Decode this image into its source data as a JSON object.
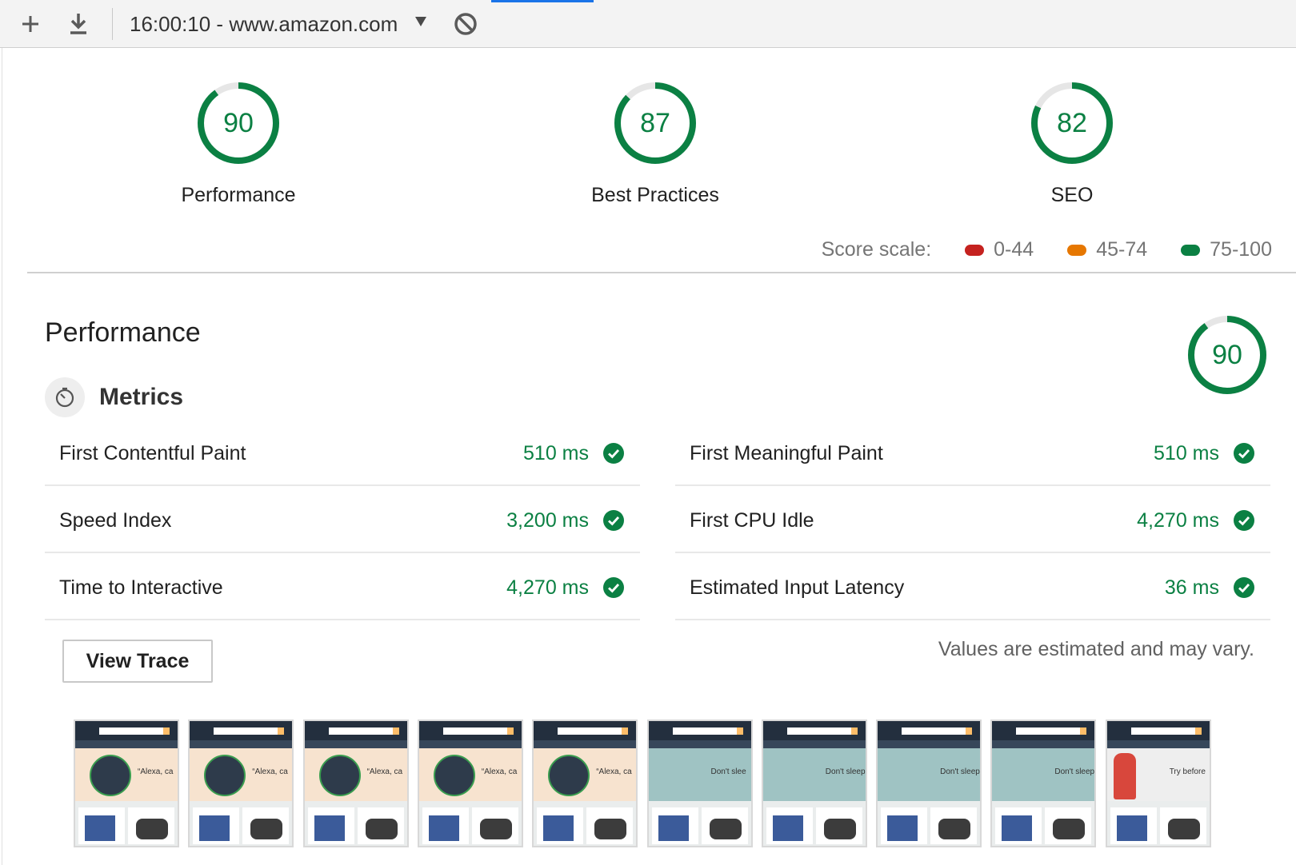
{
  "toolbar": {
    "url_label": "16:00:10 - www.amazon.com",
    "icons": [
      "plus-icon",
      "download-icon",
      "caret-down-icon",
      "block-icon"
    ]
  },
  "categories": [
    {
      "name": "Performance",
      "score": 90
    },
    {
      "name": "Best Practices",
      "score": 87
    },
    {
      "name": "SEO",
      "score": 82
    }
  ],
  "score_scale": {
    "label": "Score scale:",
    "ranges": [
      {
        "label": "0-44",
        "color": "#c5221f"
      },
      {
        "label": "45-74",
        "color": "#e67700"
      },
      {
        "label": "75-100",
        "color": "#0b8043"
      }
    ]
  },
  "section": {
    "title": "Performance",
    "score": 90,
    "metrics_title": "Metrics"
  },
  "metrics": [
    {
      "name": "First Contentful Paint",
      "value": "510 ms"
    },
    {
      "name": "First Meaningful Paint",
      "value": "510 ms"
    },
    {
      "name": "Speed Index",
      "value": "3,200 ms"
    },
    {
      "name": "First CPU Idle",
      "value": "4,270 ms"
    },
    {
      "name": "Time to Interactive",
      "value": "4,270 ms"
    },
    {
      "name": "Estimated Input Latency",
      "value": "36 ms"
    }
  ],
  "view_trace_label": "View Trace",
  "note": "Values are estimated and may vary.",
  "filmstrip": {
    "frames": [
      {
        "hero": "echo",
        "caption": "“Alexa, ca"
      },
      {
        "hero": "echo",
        "caption": "“Alexa, ca"
      },
      {
        "hero": "echo",
        "caption": "“Alexa, ca"
      },
      {
        "hero": "echo",
        "caption": "“Alexa, ca"
      },
      {
        "hero": "echo",
        "caption": "“Alexa, ca"
      },
      {
        "hero": "bedroom",
        "caption": "Don't slee"
      },
      {
        "hero": "bedroom",
        "caption": "Don't sleep i"
      },
      {
        "hero": "bedroom",
        "caption": "Don't sleep i"
      },
      {
        "hero": "bedroom",
        "caption": "Don't sleep i"
      },
      {
        "hero": "fashion",
        "caption": "Try before"
      }
    ]
  },
  "colors": {
    "pass": "#0b8043",
    "gauge_track": "#e6e6e6",
    "echo_bg": "#f7e3cf",
    "bedroom_bg": "#9fc3c3",
    "fashion_bg": "#eeeeee"
  }
}
